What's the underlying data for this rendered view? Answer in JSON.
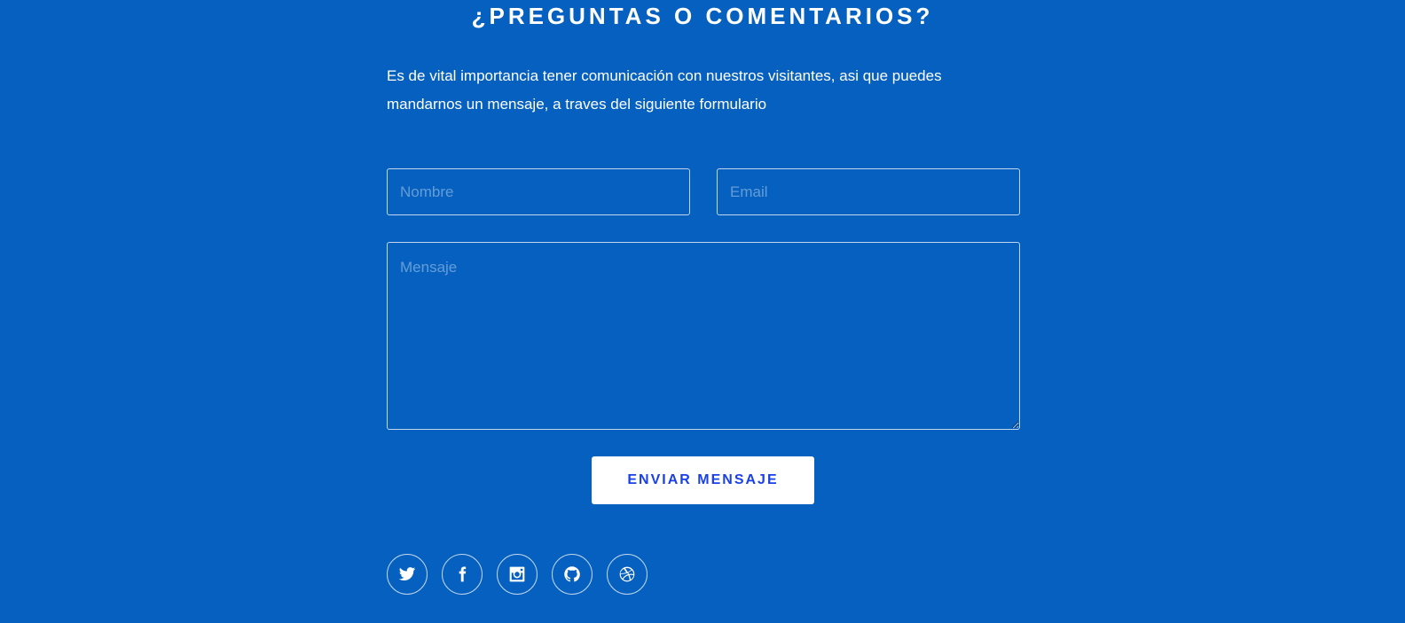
{
  "contact": {
    "title": "¿PREGUNTAS O COMENTARIOS?",
    "intro": "Es de vital importancia tener comunicación con nuestros visitantes, asi que puedes mandarnos un mensaje, a traves del siguiente formulario",
    "form": {
      "name_placeholder": "Nombre",
      "email_placeholder": "Email",
      "message_placeholder": "Mensaje",
      "submit_label": "ENVIAR MENSAJE"
    },
    "social": [
      {
        "icon": "twitter-icon"
      },
      {
        "icon": "facebook-icon"
      },
      {
        "icon": "instagram-icon"
      },
      {
        "icon": "github-icon"
      },
      {
        "icon": "dribbble-icon"
      }
    ]
  },
  "colors": {
    "background": "#0560bf",
    "button_text": "#1a40ea",
    "button_bg": "#ffffff"
  }
}
